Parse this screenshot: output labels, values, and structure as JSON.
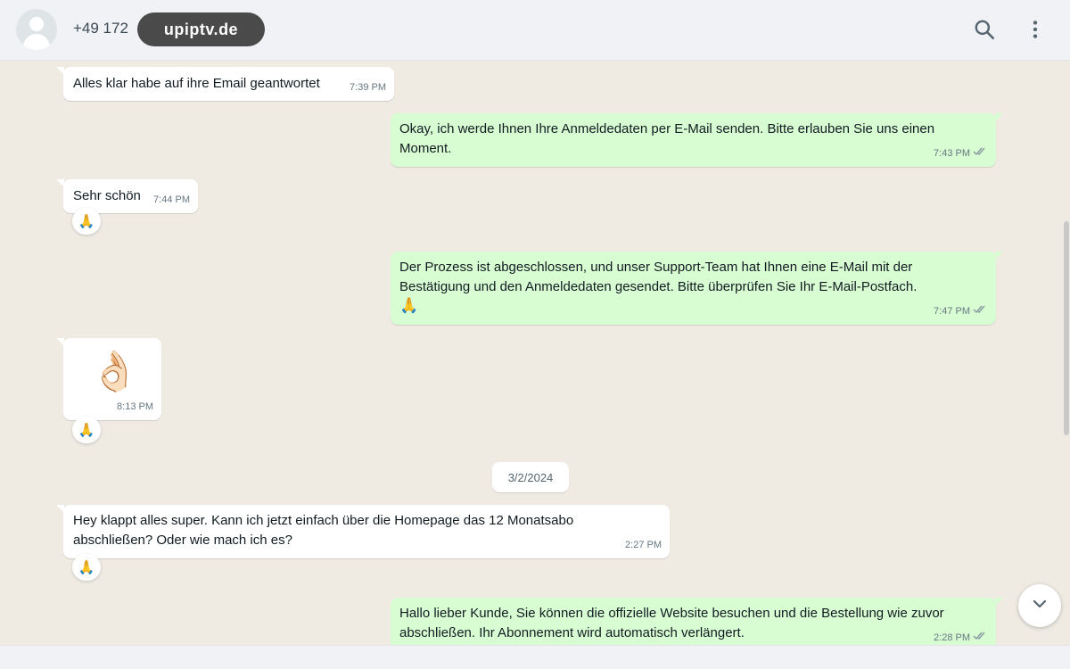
{
  "header": {
    "contact_number": "+49 172",
    "brand_label": "upiptv.de",
    "search_icon": "search-icon",
    "menu_icon": "vertical-dots-icon"
  },
  "colors": {
    "incoming_bubble": "#ffffff",
    "outgoing_bubble": "#d9fdd3",
    "chat_background": "#efeae2",
    "header_background": "#f0f2f5",
    "brand_pill": "#4a4a4a",
    "meta_text": "#667781",
    "read_ticks": "#667781"
  },
  "messages": [
    {
      "direction": "incoming",
      "text": "Alles klar habe auf ihre Email geantwortet",
      "time": "7:39 PM"
    },
    {
      "direction": "outgoing",
      "text": "Okay, ich werde Ihnen Ihre Anmeldedaten per E-Mail senden. Bitte erlauben Sie uns einen Moment.",
      "time": "7:43 PM",
      "status": "read"
    },
    {
      "direction": "incoming",
      "text": "Sehr schön",
      "time": "7:44 PM",
      "reaction": "🙏"
    },
    {
      "direction": "outgoing",
      "text": "Der Prozess ist abgeschlossen, und unser Support-Team hat Ihnen eine E-Mail mit der Bestätigung und den Anmeldedaten gesendet. Bitte überprüfen Sie Ihr E-Mail-Postfach.",
      "emoji_line": "🙏",
      "time": "7:47 PM",
      "status": "read"
    },
    {
      "direction": "incoming",
      "text": "👌🏻",
      "time": "8:13 PM",
      "reaction": "🙏"
    },
    {
      "direction": "incoming",
      "text": "Hey klappt alles super. Kann ich jetzt einfach über die Homepage das 12 Monatsabo abschließen? Oder wie mach ich es?",
      "time": "2:27 PM",
      "reaction": "🙏"
    },
    {
      "direction": "outgoing",
      "text": "Hallo lieber Kunde, Sie können die offizielle Website besuchen und die Bestellung wie zuvor abschließen. Ihr Abonnement wird automatisch verlängert.",
      "time": "2:28 PM",
      "status": "read"
    }
  ],
  "date_divider": "3/2/2024",
  "scroll_down_icon": "chevron-down-icon",
  "read_status_icon": "double-check-icon"
}
